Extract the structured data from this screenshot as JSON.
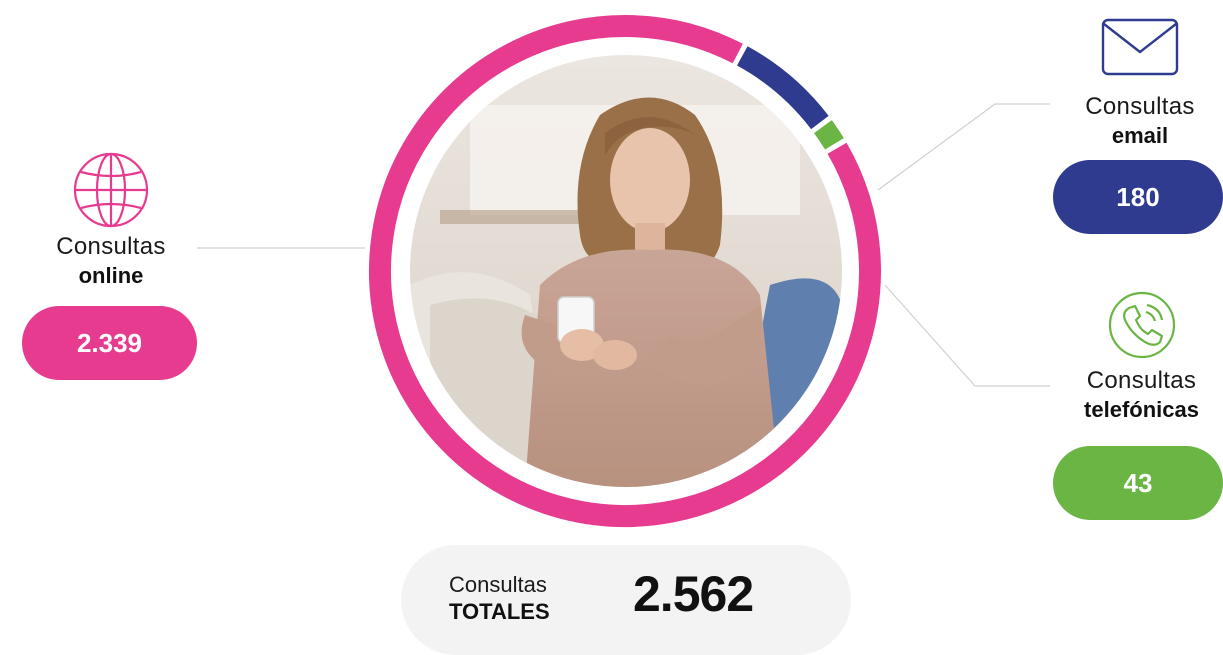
{
  "colors": {
    "online": "#e73b90",
    "email": "#2e3b8f",
    "telefonicas": "#6ab544",
    "total_bg": "#f3f3f3",
    "connector": "#d0d0d0"
  },
  "chart_data": {
    "type": "pie",
    "style": "donut",
    "slices": [
      {
        "label": "Consultas online",
        "value": 2339,
        "color": "#e73b90"
      },
      {
        "label": "Consultas email",
        "value": 180,
        "color": "#2e3b8f"
      },
      {
        "label": "Consultas telefónicas",
        "value": 43,
        "color": "#6ab544"
      }
    ],
    "total": 2562
  },
  "online": {
    "label_top": "Consultas",
    "label_bottom": "online",
    "value_text": "2.339",
    "icon": "globe-icon"
  },
  "email": {
    "label_top": "Consultas",
    "label_bottom": "email",
    "value_text": "180",
    "icon": "envelope-icon"
  },
  "telefonicas": {
    "label_top": "Consultas",
    "label_bottom": "telefónicas",
    "value_text": "43",
    "icon": "phone-icon"
  },
  "total": {
    "label_top": "Consultas",
    "label_bottom": "TOTALES",
    "value_text": "2.562"
  }
}
